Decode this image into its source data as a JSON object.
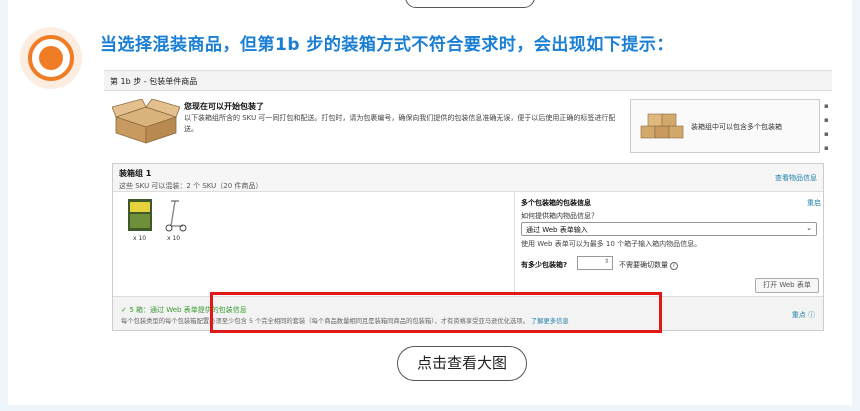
{
  "headline": "当选择混装商品，但第1b 步的装箱方式不符合要求时，会出现如下提示：",
  "view_large_button": "点击查看大图",
  "screenshot": {
    "step_label": "第 1b 步 - 包装单件商品",
    "intro_title": "您现在可以开始包装了",
    "intro_text": "以下装箱组所含的 SKU 可一同打包和配送。打包时，请为包裹编号，确保向我们提供的包装信息准确无误，便于以后使用正确的标签进行配送。",
    "tip_text": "装箱组中可以包含多个包装箱",
    "group": {
      "title": "装箱组 1",
      "subtitle": "这些 SKU 可以混装：2 个 SKU（20 件商品）",
      "view_link": "查看物品信息",
      "products": [
        {
          "qty": "x 10"
        },
        {
          "qty": "x 10"
        }
      ]
    },
    "form": {
      "title": "多个包装箱的包装信息",
      "reset": "重启",
      "question": "如何提供箱内物品信息？",
      "select_value": "通过 Web 表单输入",
      "help": "使用 Web 表单可以为最多 10 个箱子输入箱内物品信息。",
      "count_label": "有多少包装箱?",
      "no_need": "不需要确切数量",
      "open_button": "打开 Web 表单"
    },
    "alert": {
      "title": "5 箱：通过 Web 表单提供的包装信息",
      "desc": "每个包装类型的每个包装箱配置必须至少包含 5 个完全相同的套装（每个商品数量相同且是装箱同商品的包装箱），才有资格享受亚马逊优化选项。",
      "learn_more": "了解更多信息",
      "key_info": "重点"
    }
  },
  "colors": {
    "headline": "#1a7fd4",
    "accent_orange": "#f07d26",
    "alert_red": "#e01818",
    "success_green": "#3a9b2f",
    "link": "#1d7fa8"
  }
}
